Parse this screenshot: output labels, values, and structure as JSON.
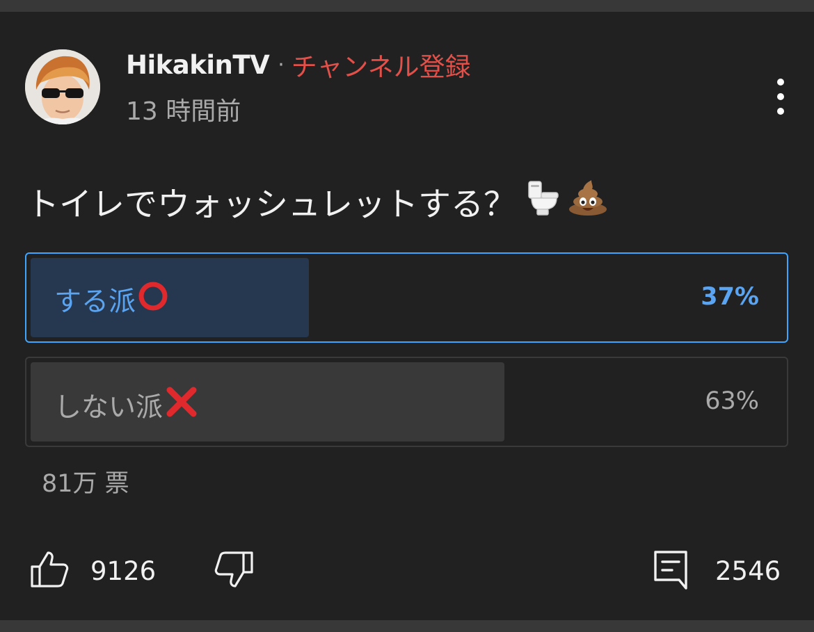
{
  "post": {
    "channel_name": "HikakinTV",
    "separator": "·",
    "subscribe_label": "チャンネル登録",
    "time_ago": "13 時間前",
    "question_text": "トイレでウォッシュレットする？",
    "question_emojis": [
      "toilet-icon",
      "poop-icon"
    ]
  },
  "poll": {
    "options": [
      {
        "label": "する派",
        "emoji": "red-circle-icon",
        "percent_label": "37%",
        "percent": 37,
        "selected": true
      },
      {
        "label": "しない派",
        "emoji": "red-cross-icon",
        "percent_label": "63%",
        "percent": 63,
        "selected": false
      }
    ],
    "votes_label": "81万 票"
  },
  "actions": {
    "like_count": "9126",
    "comment_count": "2546"
  },
  "colors": {
    "background": "#212121",
    "subscribe": "#e2504a",
    "selected_accent": "#3ea6ff",
    "selected_text": "#5aa4f2"
  }
}
